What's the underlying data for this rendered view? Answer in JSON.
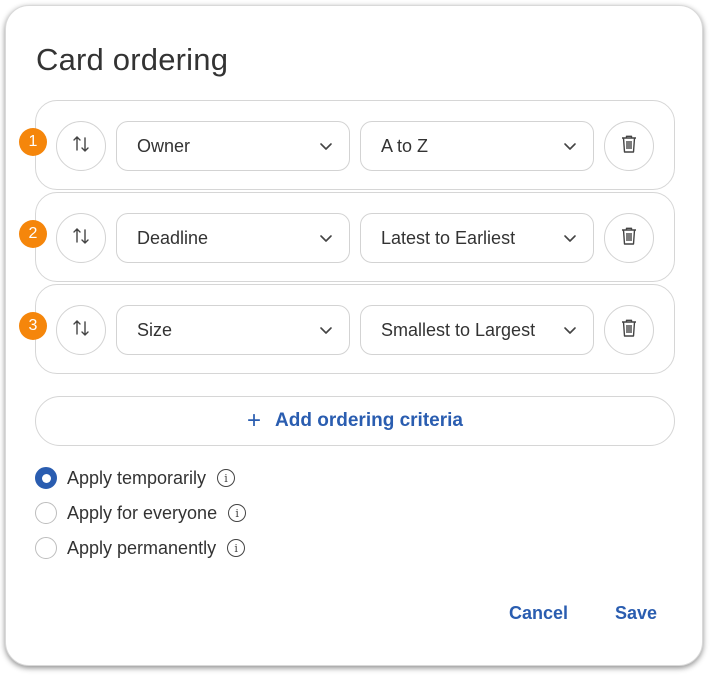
{
  "dialog": {
    "title": "Card ordering"
  },
  "criteria": [
    {
      "index": "1",
      "field": "Owner",
      "direction": "A to Z"
    },
    {
      "index": "2",
      "field": "Deadline",
      "direction": "Latest to Earliest"
    },
    {
      "index": "3",
      "field": "Size",
      "direction": "Smallest to Largest"
    }
  ],
  "add_button": {
    "icon": "+",
    "label": "Add ordering criteria"
  },
  "apply_options": [
    {
      "label": "Apply temporarily",
      "checked": true
    },
    {
      "label": "Apply for everyone",
      "checked": false
    },
    {
      "label": "Apply permanently",
      "checked": false
    }
  ],
  "footer": {
    "cancel_label": "Cancel",
    "save_label": "Save"
  },
  "colors": {
    "accent": "#2a5db0",
    "badge": "#f5860b"
  },
  "icons": {
    "sort": "swap-vertical-icon",
    "delete": "trash-icon",
    "dropdown": "chevron-down-icon",
    "info": "info-icon"
  }
}
